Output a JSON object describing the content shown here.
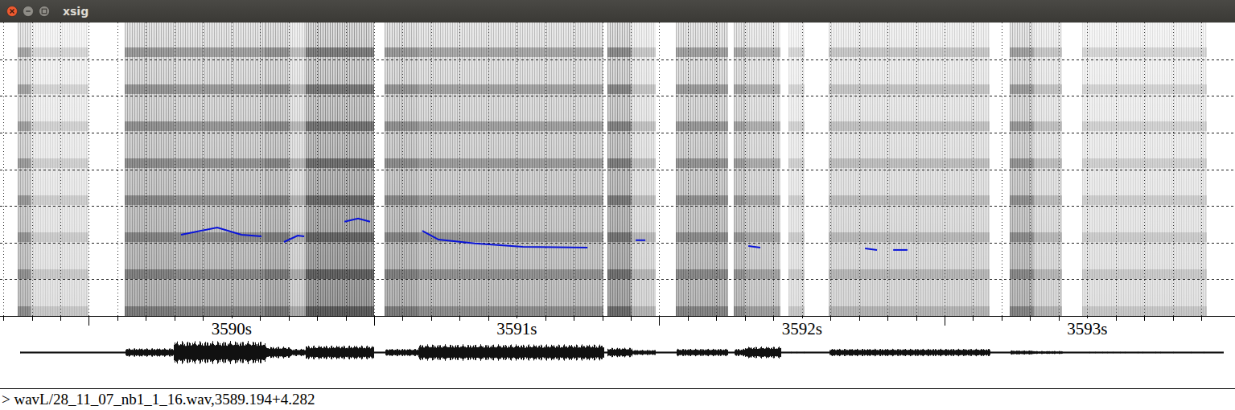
{
  "window": {
    "title": "xsig"
  },
  "spectrogram": {
    "segments": [
      {
        "start": 3589.25,
        "end": 3589.296,
        "level": 0.55,
        "amp": 0.05
      },
      {
        "start": 3589.296,
        "end": 3589.499,
        "level": 0.25,
        "amp": 0.03
      },
      {
        "start": 3589.626,
        "end": 3589.795,
        "level": 0.65,
        "amp": 0.35
      },
      {
        "start": 3589.795,
        "end": 3590.119,
        "level": 0.6,
        "amp": 1.0
      },
      {
        "start": 3590.119,
        "end": 3590.204,
        "level": 0.7,
        "amp": 0.5
      },
      {
        "start": 3590.204,
        "end": 3590.26,
        "level": 0.4,
        "amp": 0.3
      },
      {
        "start": 3590.26,
        "end": 3590.5,
        "level": 0.85,
        "amp": 0.6
      },
      {
        "start": 3590.537,
        "end": 3590.655,
        "level": 0.65,
        "amp": 0.3
      },
      {
        "start": 3590.655,
        "end": 3591.304,
        "level": 0.55,
        "amp": 0.7
      },
      {
        "start": 3591.318,
        "end": 3591.403,
        "level": 0.75,
        "amp": 0.4
      },
      {
        "start": 3591.403,
        "end": 3591.487,
        "level": 0.35,
        "amp": 0.2
      },
      {
        "start": 3591.558,
        "end": 3591.741,
        "level": 0.6,
        "amp": 0.3
      },
      {
        "start": 3591.761,
        "end": 3591.798,
        "level": 0.55,
        "amp": 0.3
      },
      {
        "start": 3591.798,
        "end": 3591.925,
        "level": 0.45,
        "amp": 0.5
      },
      {
        "start": 3591.953,
        "end": 3592.009,
        "level": 0.25,
        "amp": 0.05
      },
      {
        "start": 3592.094,
        "end": 3592.658,
        "level": 0.35,
        "amp": 0.3
      },
      {
        "start": 3592.729,
        "end": 3592.813,
        "level": 0.6,
        "amp": 0.15
      },
      {
        "start": 3592.813,
        "end": 3592.912,
        "level": 0.35,
        "amp": 0.1
      },
      {
        "start": 3592.982,
        "end": 3593.42,
        "level": 0.25,
        "amp": 0.05
      }
    ],
    "pitch_tracks": [
      {
        "points": [
          [
            3589.823,
            0.277
          ],
          [
            3589.95,
            0.301
          ],
          [
            3590.035,
            0.277
          ],
          [
            3590.105,
            0.271
          ]
        ]
      },
      {
        "points": [
          [
            3590.184,
            0.252
          ],
          [
            3590.232,
            0.274
          ],
          [
            3590.255,
            0.271
          ]
        ]
      },
      {
        "points": [
          [
            3590.396,
            0.321
          ],
          [
            3590.444,
            0.332
          ],
          [
            3590.486,
            0.321
          ]
        ]
      },
      {
        "points": [
          [
            3590.669,
            0.29
          ],
          [
            3590.726,
            0.26
          ],
          [
            3590.853,
            0.247
          ],
          [
            3591.022,
            0.236
          ],
          [
            3591.248,
            0.233
          ]
        ]
      },
      {
        "points": [
          [
            3591.417,
            0.258
          ],
          [
            3591.451,
            0.258
          ]
        ]
      },
      {
        "points": [
          [
            3591.812,
            0.238
          ],
          [
            3591.854,
            0.233
          ]
        ]
      },
      {
        "points": [
          [
            3592.221,
            0.23
          ],
          [
            3592.263,
            0.225
          ]
        ]
      },
      {
        "points": [
          [
            3592.32,
            0.225
          ],
          [
            3592.37,
            0.225
          ]
        ]
      }
    ]
  },
  "axis": {
    "ticks": [
      {
        "label": "3590s"
      },
      {
        "label": "3591s"
      },
      {
        "label": "3592s"
      },
      {
        "label": "3593s"
      }
    ]
  },
  "status_bar": "> wavL/28_11_07_nb1_1_16.wav,3589.194+4.282"
}
